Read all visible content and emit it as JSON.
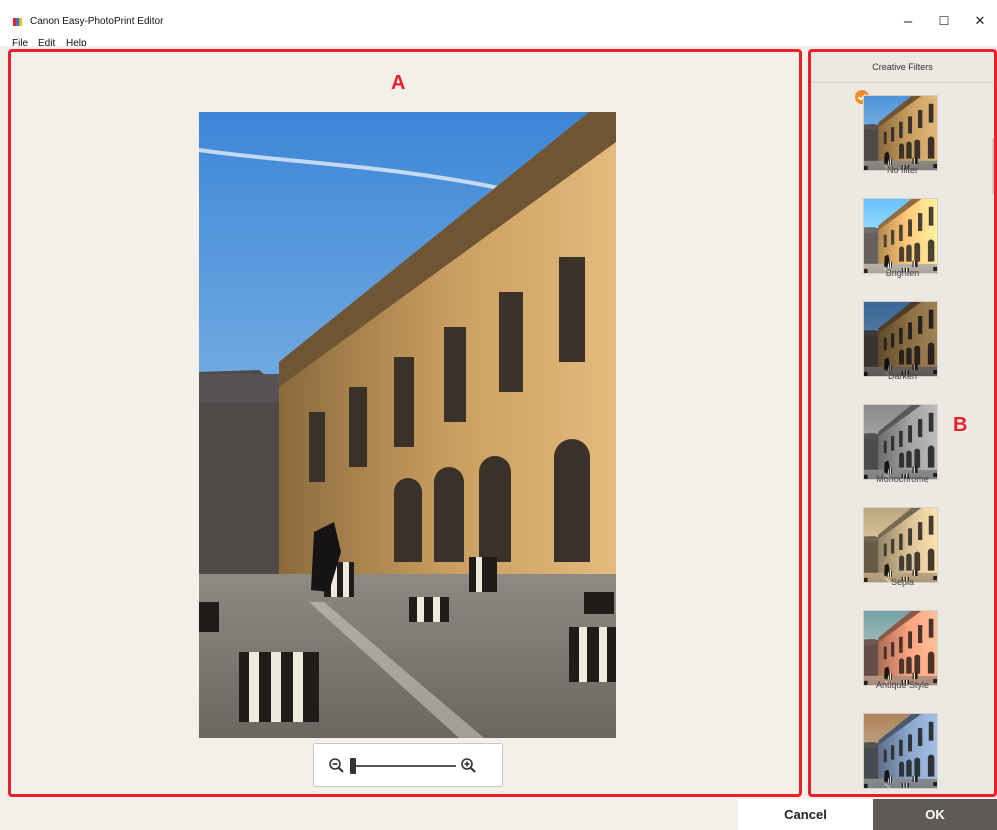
{
  "window": {
    "title": "Canon Easy-PhotoPrint Editor",
    "minimize_glyph": "–",
    "maximize_glyph": "☐",
    "close_glyph": "✕"
  },
  "menu": [
    {
      "label": "File"
    },
    {
      "label": "Edit"
    },
    {
      "label": "Help"
    }
  ],
  "callouts": {
    "a": "A",
    "b": "B"
  },
  "filters_panel": {
    "header": "Creative Filters",
    "items": [
      {
        "label": "No filter",
        "selected": true
      },
      {
        "label": "Brighten",
        "selected": false
      },
      {
        "label": "Darken",
        "selected": false
      },
      {
        "label": "Monochrome",
        "selected": false
      },
      {
        "label": "Sepia",
        "selected": false
      },
      {
        "label": "Antique Style",
        "selected": false
      },
      {
        "label": "",
        "selected": false
      }
    ]
  },
  "buttons": {
    "cancel": "Cancel",
    "ok": "OK"
  },
  "colors": {
    "callout_red": "#e8202a",
    "selected_check": "#f28c28",
    "ok_button_bg": "#5e5b57"
  }
}
